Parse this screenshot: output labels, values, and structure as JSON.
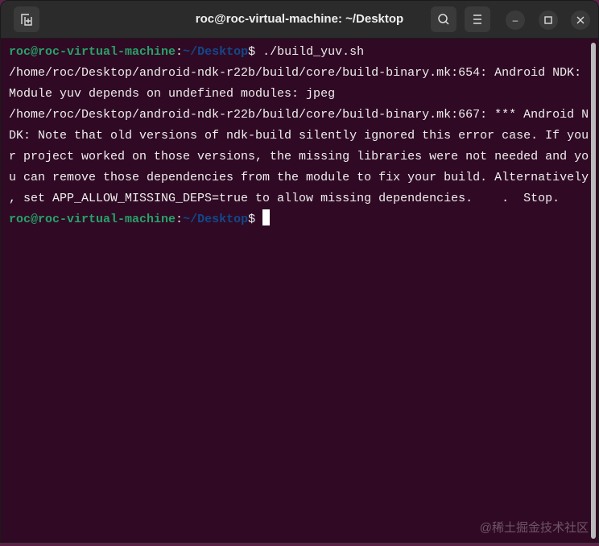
{
  "window": {
    "title": "roc@roc-virtual-machine: ~/Desktop"
  },
  "terminal": {
    "prompt_user": "roc@roc-virtual-machine",
    "prompt_sep": ":",
    "prompt_path": "~/Desktop",
    "prompt_end": "$",
    "command": " ./build_yuv.sh",
    "output_lines": [
      "/home/roc/Desktop/android-ndk-r22b/build/core/build-binary.mk:654: Android NDK:",
      "Module yuv depends on undefined modules: jpeg",
      "/home/roc/Desktop/android-ndk-r22b/build/core/build-binary.mk:667: *** Android N",
      "DK: Note that old versions of ndk-build silently ignored this error case. If you",
      "r project worked on those versions, the missing libraries were not needed and yo",
      "u can remove those dependencies from the module to fix your build. Alternatively",
      ", set APP_ALLOW_MISSING_DEPS=true to allow missing dependencies.    .  Stop."
    ]
  },
  "watermark": "@稀土掘金技术社区",
  "colors": {
    "bg": "#300a24",
    "user": "#26a269",
    "path": "#12488b"
  }
}
